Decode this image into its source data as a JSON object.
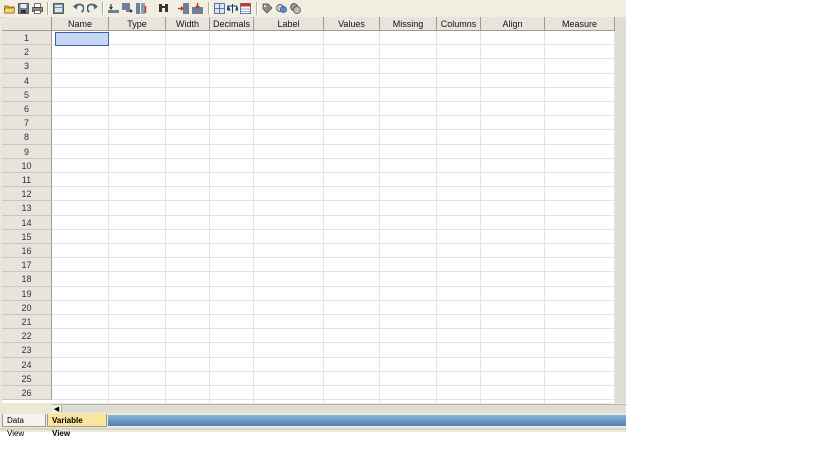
{
  "toolbar": {
    "icons": [
      "open-folder-icon",
      "save-icon",
      "print-icon",
      "dialog-recall-icon",
      "undo-icon",
      "redo-icon",
      "goto-case-icon",
      "goto-variable-icon",
      "variables-info-icon",
      "find-icon",
      "insert-cases-icon",
      "insert-variable-icon",
      "split-file-icon",
      "weight-cases-icon",
      "select-cases-icon",
      "value-labels-icon",
      "use-sets-icon",
      "show-all-variables-icon"
    ]
  },
  "grid": {
    "columns": [
      "Name",
      "Type",
      "Width",
      "Decimals",
      "Label",
      "Values",
      "Missing",
      "Columns",
      "Align",
      "Measure"
    ],
    "rows": [
      "1",
      "2",
      "3",
      "4",
      "5",
      "6",
      "7",
      "8",
      "9",
      "10",
      "11",
      "12",
      "13",
      "14",
      "15",
      "16",
      "17",
      "18",
      "19",
      "20",
      "21",
      "22",
      "23",
      "24",
      "25",
      "26"
    ]
  },
  "tabs": {
    "data_view": "Data View",
    "variable_view": "Variable View",
    "active": "Variable View"
  },
  "colors": {
    "tab_active": "#fbe49b",
    "selection": "#c9d8f2",
    "tab_strip": "#6e97c5"
  }
}
